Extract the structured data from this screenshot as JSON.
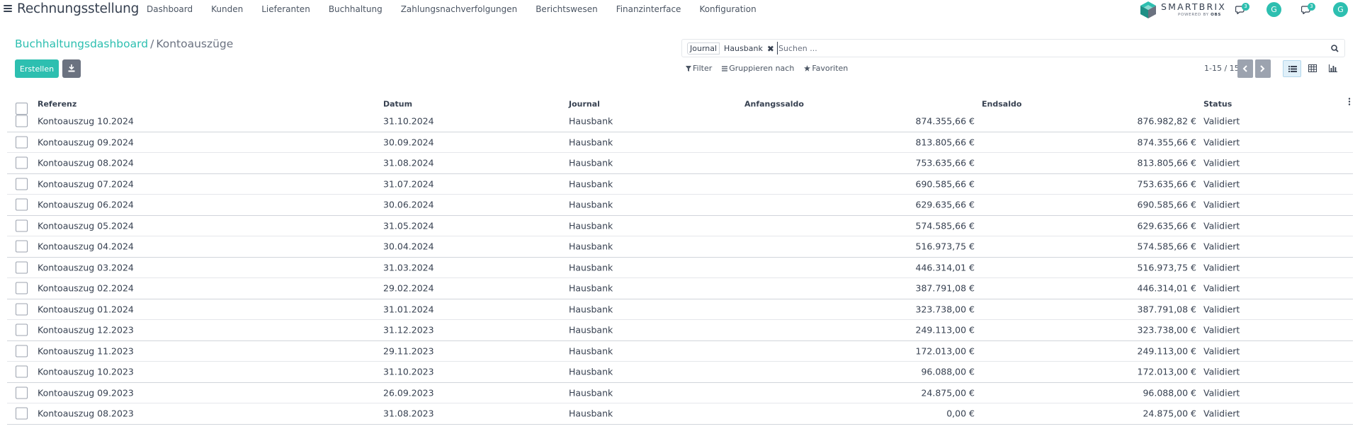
{
  "navbar": {
    "app_title": "Rechnungsstellung",
    "menu": [
      "Dashboard",
      "Kunden",
      "Lieferanten",
      "Buchhaltung",
      "Zahlungsnachverfolgungen",
      "Berichtswesen",
      "Finanzinterface",
      "Konfiguration"
    ],
    "logo": {
      "word": "SMARTBRIX",
      "sub_prefix": "POWERED BY",
      "sub_brand": "OBS"
    },
    "chat_badges": [
      "3",
      "3"
    ],
    "avatar_letter": "G",
    "accent_color": "#2dbfb0"
  },
  "breadcrumb": {
    "parent": "Buchhaltungsdashboard",
    "separator": "/",
    "current": "Kontoauszüge"
  },
  "actions": {
    "create_label": "Erstellen",
    "download_icon": "download-icon"
  },
  "search": {
    "facet_label": "Journal",
    "facet_value": "Hausbank",
    "placeholder": "Suchen ..."
  },
  "filters": {
    "filter_label": "Filter",
    "group_label": "Gruppieren nach",
    "favorites_label": "Favoriten"
  },
  "pager": {
    "text": "1-15 / 15"
  },
  "views": [
    "list-view-icon",
    "pivot-view-icon",
    "graph-view-icon"
  ],
  "table": {
    "columns": {
      "reference": "Referenz",
      "date": "Datum",
      "journal": "Journal",
      "start_balance": "Anfangssaldo",
      "end_balance": "Endsaldo",
      "status": "Status"
    },
    "rows": [
      {
        "reference": "Kontoauszug 10.2024",
        "date": "31.10.2024",
        "journal": "Hausbank",
        "start_balance": "874.355,66 €",
        "end_balance": "876.982,82 €",
        "status": "Validiert"
      },
      {
        "reference": "Kontoauszug 09.2024",
        "date": "30.09.2024",
        "journal": "Hausbank",
        "start_balance": "813.805,66 €",
        "end_balance": "874.355,66 €",
        "status": "Validiert"
      },
      {
        "reference": "Kontoauszug 08.2024",
        "date": "31.08.2024",
        "journal": "Hausbank",
        "start_balance": "753.635,66 €",
        "end_balance": "813.805,66 €",
        "status": "Validiert"
      },
      {
        "reference": "Kontoauszug 07.2024",
        "date": "31.07.2024",
        "journal": "Hausbank",
        "start_balance": "690.585,66 €",
        "end_balance": "753.635,66 €",
        "status": "Validiert"
      },
      {
        "reference": "Kontoauszug 06.2024",
        "date": "30.06.2024",
        "journal": "Hausbank",
        "start_balance": "629.635,66 €",
        "end_balance": "690.585,66 €",
        "status": "Validiert"
      },
      {
        "reference": "Kontoauszug 05.2024",
        "date": "31.05.2024",
        "journal": "Hausbank",
        "start_balance": "574.585,66 €",
        "end_balance": "629.635,66 €",
        "status": "Validiert"
      },
      {
        "reference": "Kontoauszug 04.2024",
        "date": "30.04.2024",
        "journal": "Hausbank",
        "start_balance": "516.973,75 €",
        "end_balance": "574.585,66 €",
        "status": "Validiert"
      },
      {
        "reference": "Kontoauszug 03.2024",
        "date": "31.03.2024",
        "journal": "Hausbank",
        "start_balance": "446.314,01 €",
        "end_balance": "516.973,75 €",
        "status": "Validiert"
      },
      {
        "reference": "Kontoauszug 02.2024",
        "date": "29.02.2024",
        "journal": "Hausbank",
        "start_balance": "387.791,08 €",
        "end_balance": "446.314,01 €",
        "status": "Validiert"
      },
      {
        "reference": "Kontoauszug 01.2024",
        "date": "31.01.2024",
        "journal": "Hausbank",
        "start_balance": "323.738,00 €",
        "end_balance": "387.791,08 €",
        "status": "Validiert"
      },
      {
        "reference": "Kontoauszug 12.2023",
        "date": "31.12.2023",
        "journal": "Hausbank",
        "start_balance": "249.113,00 €",
        "end_balance": "323.738,00 €",
        "status": "Validiert"
      },
      {
        "reference": "Kontoauszug 11.2023",
        "date": "29.11.2023",
        "journal": "Hausbank",
        "start_balance": "172.013,00 €",
        "end_balance": "249.113,00 €",
        "status": "Validiert"
      },
      {
        "reference": "Kontoauszug 10.2023",
        "date": "31.10.2023",
        "journal": "Hausbank",
        "start_balance": "96.088,00 €",
        "end_balance": "172.013,00 €",
        "status": "Validiert"
      },
      {
        "reference": "Kontoauszug 09.2023",
        "date": "26.09.2023",
        "journal": "Hausbank",
        "start_balance": "24.875,00 €",
        "end_balance": "96.088,00 €",
        "status": "Validiert"
      },
      {
        "reference": "Kontoauszug 08.2023",
        "date": "31.08.2023",
        "journal": "Hausbank",
        "start_balance": "0,00 €",
        "end_balance": "24.875,00 €",
        "status": "Validiert"
      }
    ]
  }
}
